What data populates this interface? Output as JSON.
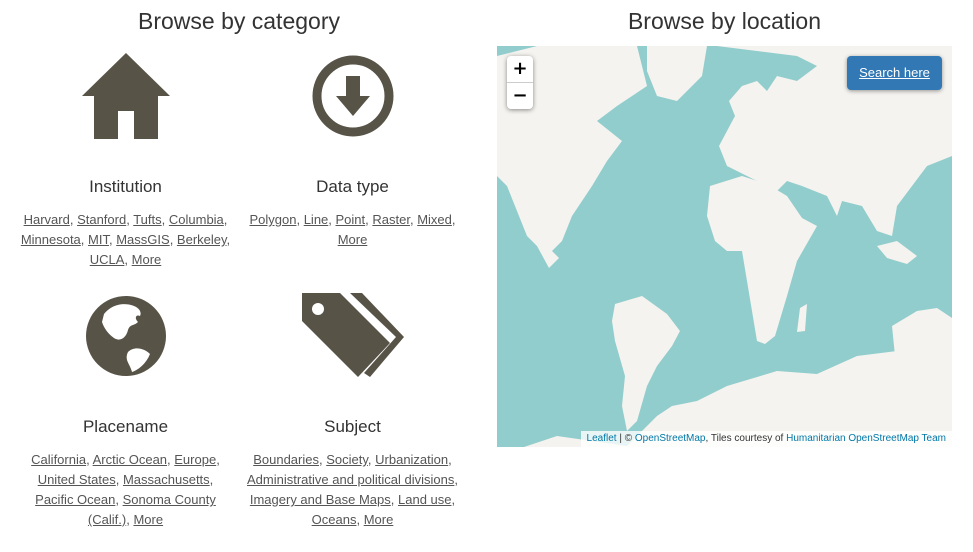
{
  "category_section": {
    "title": "Browse by category",
    "categories": [
      {
        "name": "Institution",
        "icon": "home-icon",
        "links": [
          "Harvard",
          "Stanford",
          "Tufts",
          "Columbia",
          "Minnesota",
          "MIT",
          "MassGIS",
          "Berkeley",
          "UCLA",
          "More"
        ]
      },
      {
        "name": "Data type",
        "icon": "download-circle-icon",
        "links": [
          "Polygon",
          "Line",
          "Point",
          "Raster",
          "Mixed",
          "More"
        ]
      },
      {
        "name": "Placename",
        "icon": "globe-icon",
        "links": [
          "California",
          "Arctic Ocean",
          "Europe",
          "United States",
          "Massachusetts",
          "Pacific Ocean",
          "Sonoma County (Calif.)",
          "More"
        ]
      },
      {
        "name": "Subject",
        "icon": "tags-icon",
        "links": [
          "Boundaries",
          "Society",
          "Urbanization",
          "Administrative and political divisions",
          "Imagery and Base Maps",
          "Land use",
          "Oceans",
          "More"
        ]
      }
    ]
  },
  "location_section": {
    "title": "Browse by location",
    "map": {
      "zoom_in_label": "+",
      "zoom_out_label": "−",
      "search_button_label": "Search here",
      "attribution": {
        "leaflet": "Leaflet",
        "separator": " | © ",
        "osm": "OpenStreetMap",
        "tiles_text": ", Tiles courtesy of ",
        "hot": "Humanitarian OpenStreetMap Team"
      },
      "colors": {
        "water": "#91cdcc",
        "land": "#f5f3ef",
        "button": "#3278b4"
      }
    }
  },
  "colors": {
    "icon": "#575347",
    "text": "#333333",
    "link": "#555555"
  }
}
